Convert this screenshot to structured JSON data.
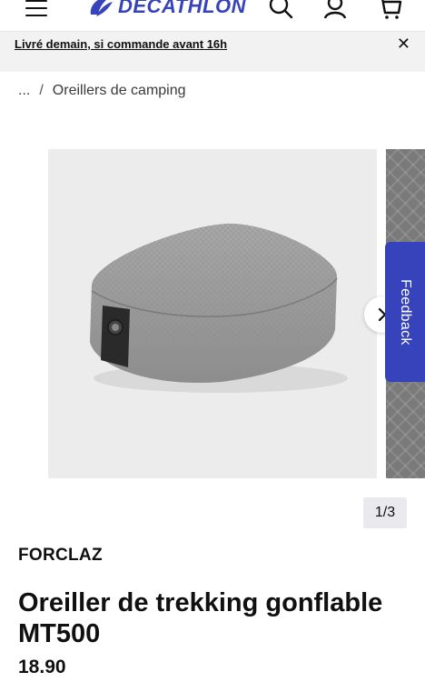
{
  "header": {
    "logo_text": "DECATHLON",
    "brand_color": "#3643ba",
    "icons": [
      "menu-icon",
      "search-icon",
      "account-icon",
      "cart-icon"
    ]
  },
  "promo": {
    "text": "Livré demain, si commande avant 16h",
    "close_label": "✕"
  },
  "breadcrumb": {
    "ellipsis": "...",
    "separator": "/",
    "current": "Oreillers de camping"
  },
  "gallery": {
    "counter": "1/3",
    "feedback_label": "Feedback"
  },
  "product": {
    "brand": "FORCLAZ",
    "title": "Oreiller de trekking gonflable MT500",
    "price": "18.90"
  }
}
